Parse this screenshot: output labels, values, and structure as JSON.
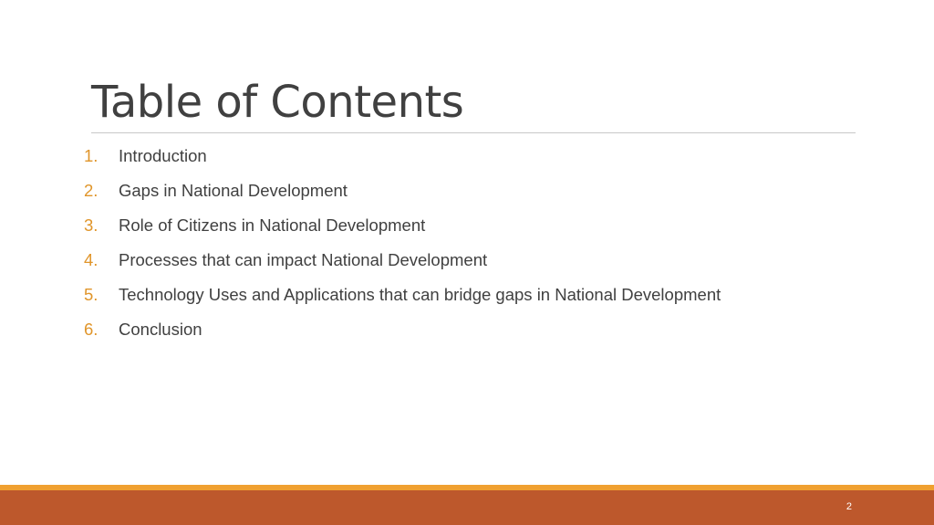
{
  "slide": {
    "title": "Table of Contents",
    "items": [
      {
        "number": "1.",
        "text": "Introduction"
      },
      {
        "number": "2.",
        "text": "Gaps in National Development"
      },
      {
        "number": "3.",
        "text": "Role of Citizens in National Development"
      },
      {
        "number": "4.",
        "text": "Processes that can impact National Development"
      },
      {
        "number": "5.",
        "text": "Technology Uses and Applications that can bridge gaps in National Development"
      },
      {
        "number": "6.",
        "text": "Conclusion"
      }
    ],
    "page_number": "2"
  },
  "colors": {
    "title_text": "#404040",
    "number_accent": "#e0952a",
    "footer_stripe": "#f0a030",
    "footer_bar": "#bd582c"
  }
}
